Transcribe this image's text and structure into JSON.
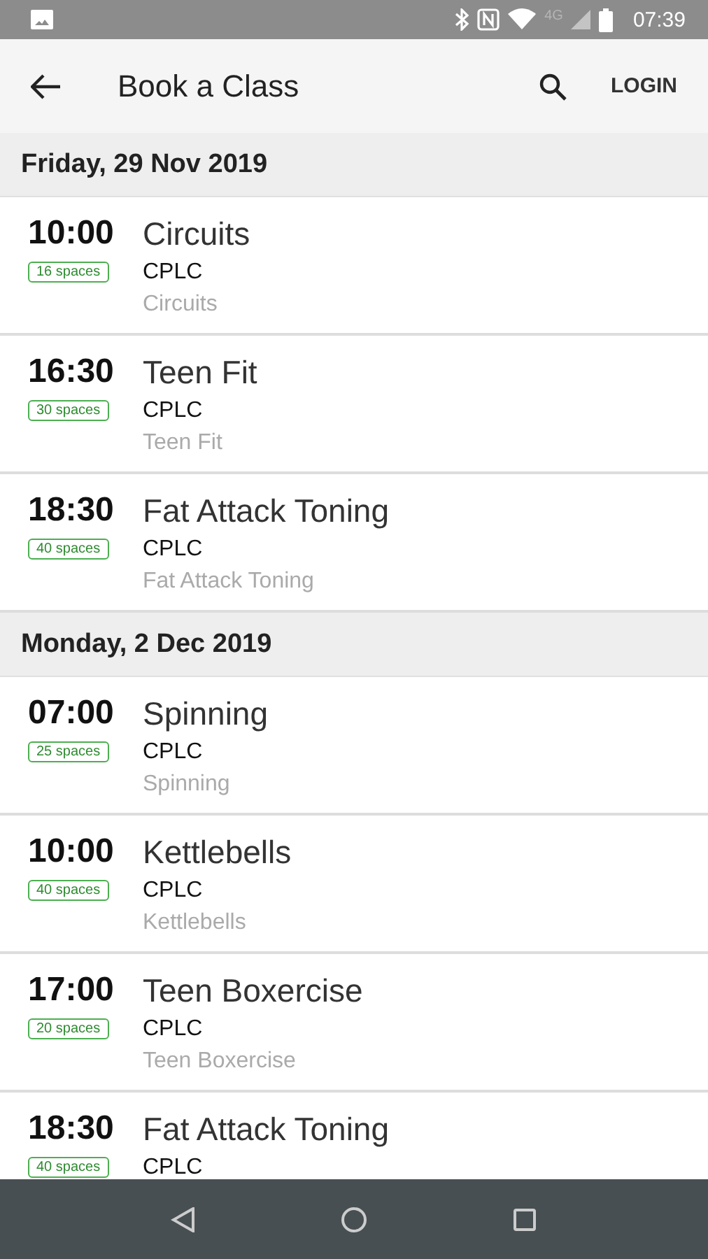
{
  "status_bar": {
    "network": "4G",
    "time": "07:39"
  },
  "app_bar": {
    "title": "Book a Class",
    "action": "LOGIN"
  },
  "sections": [
    {
      "date": "Friday, 29 Nov 2019",
      "classes": [
        {
          "time": "10:00",
          "spaces": "16 spaces",
          "name": "Circuits",
          "venue": "CPLC",
          "subtitle": "Circuits"
        },
        {
          "time": "16:30",
          "spaces": "30 spaces",
          "name": "Teen Fit",
          "venue": "CPLC",
          "subtitle": "Teen Fit"
        },
        {
          "time": "18:30",
          "spaces": "40 spaces",
          "name": "Fat Attack Toning",
          "venue": "CPLC",
          "subtitle": "Fat Attack Toning"
        }
      ]
    },
    {
      "date": "Monday, 2 Dec 2019",
      "classes": [
        {
          "time": "07:00",
          "spaces": "25 spaces",
          "name": "Spinning",
          "venue": "CPLC",
          "subtitle": "Spinning"
        },
        {
          "time": "10:00",
          "spaces": "40 spaces",
          "name": "Kettlebells",
          "venue": "CPLC",
          "subtitle": "Kettlebells"
        },
        {
          "time": "17:00",
          "spaces": "20 spaces",
          "name": "Teen Boxercise",
          "venue": "CPLC",
          "subtitle": "Teen Boxercise"
        },
        {
          "time": "18:30",
          "spaces": "40 spaces",
          "name": "Fat Attack Toning",
          "venue": "CPLC"
        }
      ]
    }
  ]
}
